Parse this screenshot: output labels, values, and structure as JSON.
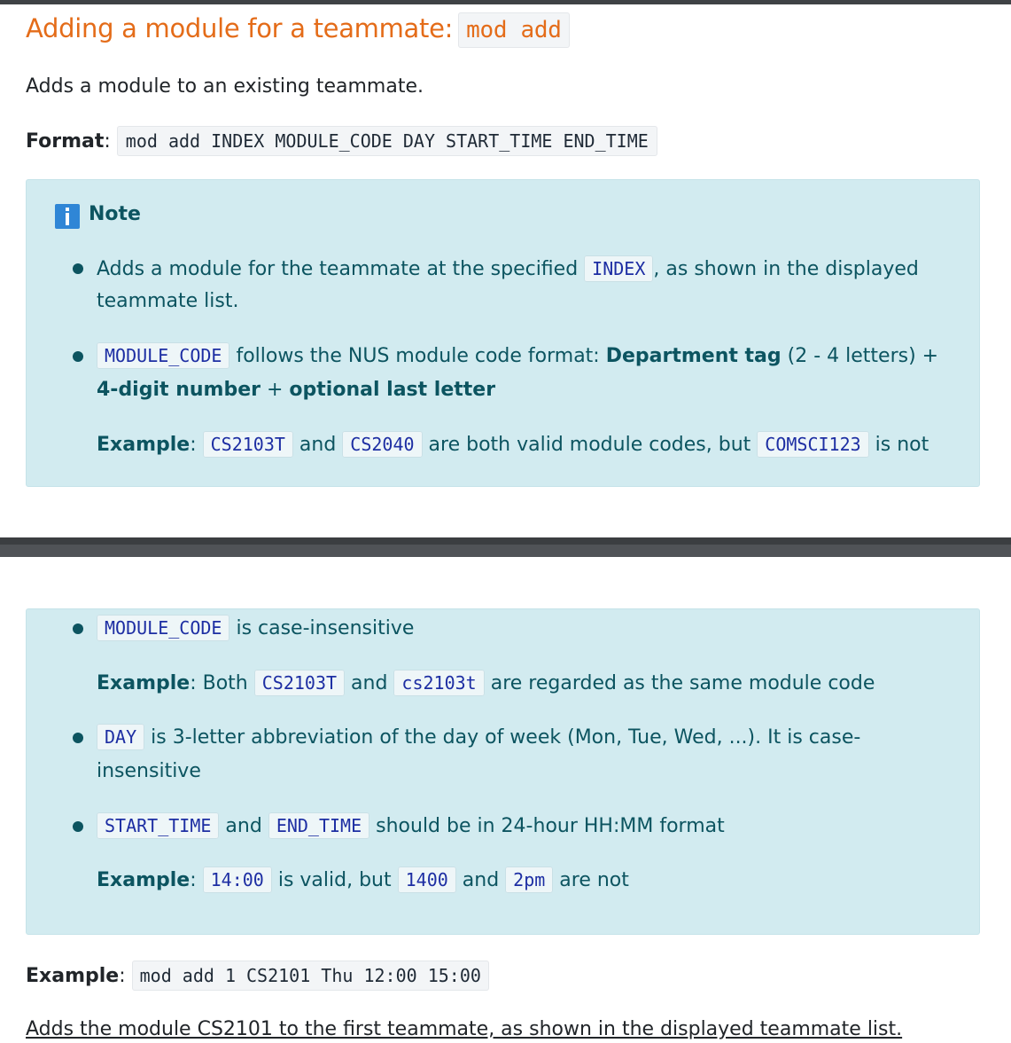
{
  "heading": {
    "text": "Adding a module for a teammate:",
    "command": "mod add"
  },
  "intro": "Adds a module to an existing teammate.",
  "format": {
    "label": "Format",
    "command": "mod add INDEX MODULE_CODE DAY START_TIME END_TIME"
  },
  "note": {
    "title": "Note",
    "icon": "info-icon",
    "items": [
      {
        "pre": "Adds a module for the teammate at the specified",
        "code": "INDEX",
        "post": ", as shown in the displayed",
        "line2": "teammate list."
      },
      {
        "code": "MODULE_CODE",
        "text": "follows the NUS module code format:",
        "bold1": "Department tag",
        "after1": "(2 - 4 letters) +",
        "bold2": "4-digit number",
        "plus": "+",
        "bold3": "optional last letter",
        "example_label": "Example",
        "ex_code1": "CS2103T",
        "ex_and": "and",
        "ex_code2": "CS2040",
        "ex_mid": "are both valid module codes, but",
        "ex_code3": "COMSCI123",
        "ex_end": "is not"
      },
      {
        "code": "MODULE_CODE",
        "text": "is case-insensitive",
        "example_label": "Example",
        "ex_pre": "Both",
        "ex_code1": "CS2103T",
        "ex_and": "and",
        "ex_code2": "cs2103t",
        "ex_end": "are regarded as the same module code"
      },
      {
        "code": "DAY",
        "text": "is 3-letter abbreviation of the day of week (Mon, Tue, Wed, ...). It is case-",
        "line2": "insensitive"
      },
      {
        "code1": "START_TIME",
        "and": "and",
        "code2": "END_TIME",
        "text": "should be in 24-hour HH:MM format",
        "example_label": "Example",
        "ex_code1": "14:00",
        "ex_mid": "is valid, but",
        "ex_code2": "1400",
        "ex_and": "and",
        "ex_code3": "2pm",
        "ex_end": "are not"
      }
    ]
  },
  "example": {
    "label": "Example",
    "command": "mod add 1 CS2101 Thu 12:00 15:00",
    "description": "Adds the module CS2101 to the first teammate, as shown in the displayed teammate list."
  },
  "colors": {
    "heading": "#e46c19",
    "callout_bg": "#d2ebf0",
    "callout_text": "#0c5460",
    "info_icon": "#2f86d6",
    "code_text_in_callout": "#1d2ea3"
  }
}
